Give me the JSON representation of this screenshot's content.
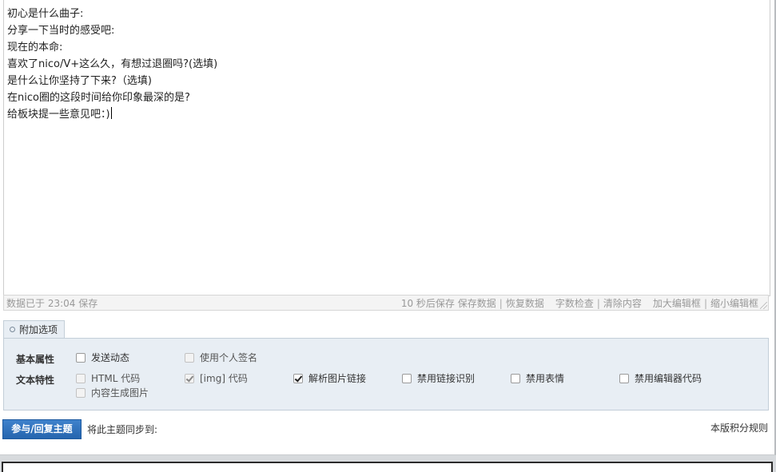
{
  "editor": {
    "lines": [
      "初心是什么曲子:",
      "分享一下当时的感受吧:",
      "现在的本命:",
      "喜欢了nico/V+这么久，有想过退圈吗?(选填)",
      "是什么让你坚持了下来?（选填)",
      "在nico圈的这段时间给你印象最深的是?",
      "给板块提一些意见吧：)"
    ]
  },
  "statusbar": {
    "saved_text": "数据已于 23:04 保存",
    "autosave": "10 秒后保存",
    "save_data": "保存数据",
    "restore_data": "恢复数据",
    "word_check": "字数检查",
    "clear_content": "清除内容",
    "enlarge_editor": "加大编辑框",
    "shrink_editor": "缩小编辑框",
    "separator": "|"
  },
  "options": {
    "tab_label": "附加选项",
    "basic_label": "基本属性",
    "text_label": "文本特性",
    "send_feed": "发送动态",
    "use_signature": "使用个人签名",
    "html_code": "HTML 代码",
    "img_code": "[img] 代码",
    "parse_img_link": "解析图片链接",
    "disable_link_detect": "禁用链接识别",
    "disable_smilies": "禁用表情",
    "disable_editor_code": "禁用编辑器代码",
    "content_to_image": "内容生成图片"
  },
  "footer": {
    "submit_label": "参与/回复主题",
    "sync_label": "将此主题同步到:",
    "rules_link": "本版积分规则"
  }
}
